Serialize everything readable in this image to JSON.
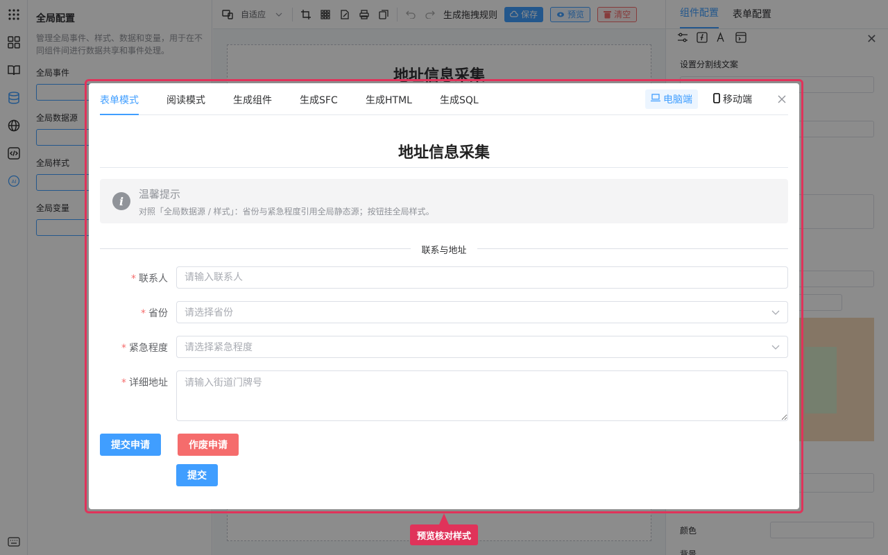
{
  "left_panel": {
    "title": "全局配置",
    "description": "管理全局事件、样式、数据和变量，用于在不同组件间进行数据共享和事件处理。",
    "sections": [
      "全局事件",
      "全局数据源",
      "全局样式",
      "全局变量"
    ]
  },
  "toolbar": {
    "size_select": "自适应",
    "rules_label": "生成拖拽规则",
    "save_label": "保存",
    "preview_label": "预览",
    "clear_label": "清空"
  },
  "canvas": {
    "title": "地址信息采集"
  },
  "right_panel": {
    "tabs": [
      "组件配置",
      "表单配置"
    ],
    "divider_text_label": "设置分割线文案",
    "color_label": "颜色",
    "background_label": "背景"
  },
  "dialog": {
    "tabs": [
      "表单模式",
      "阅读模式",
      "生成组件",
      "生成SFC",
      "生成HTML",
      "生成SQL"
    ],
    "active_tab": "表单模式",
    "device_pc": "电脑端",
    "device_mobile": "移动端",
    "form_title": "地址信息采集",
    "alert": {
      "title": "温馨提示",
      "description": "对照「全局数据源 / 样式」：省份与紧急程度引用全局静态源；按钮挂全局样式。"
    },
    "divider_label": "联系与地址",
    "fields": {
      "contact": {
        "label": "联系人",
        "placeholder": "请输入联系人"
      },
      "province": {
        "label": "省份",
        "placeholder": "请选择省份"
      },
      "urgency": {
        "label": "紧急程度",
        "placeholder": "请选择紧急程度"
      },
      "address": {
        "label": "详细地址",
        "placeholder": "请输入街道门牌号"
      }
    },
    "buttons": {
      "submit_request": "提交申请",
      "void_request": "作废申请",
      "submit": "提交"
    }
  },
  "callout": {
    "label": "预览核对样式"
  },
  "colors": {
    "primary": "#409eff",
    "danger": "#f56c6c",
    "highlight": "#e0335a"
  }
}
